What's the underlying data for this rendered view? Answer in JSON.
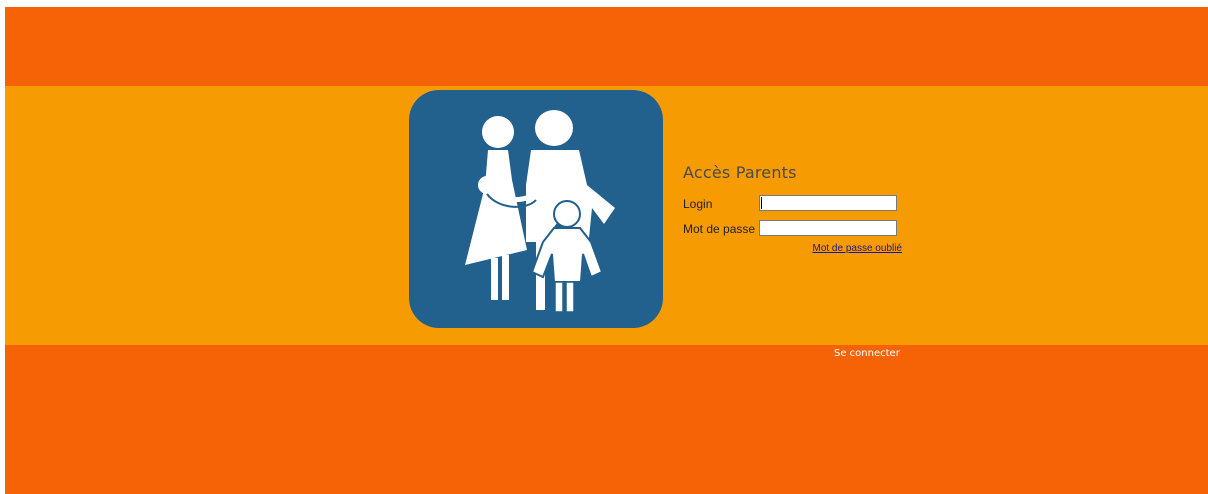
{
  "login": {
    "title": "Accès Parents",
    "login_label": "Login",
    "login_value": "",
    "password_label": "Mot de passe",
    "password_value": "",
    "forgot_password_link": "Mot de passe oublié",
    "connect_button": "Se connecter"
  },
  "logo": {
    "icon": "family-icon",
    "background_color": "#22608e"
  },
  "colors": {
    "outer_band": "#f66306",
    "middle_band": "#f69b02",
    "title_text": "#4a4a4a",
    "link": "#1a1a8c"
  }
}
